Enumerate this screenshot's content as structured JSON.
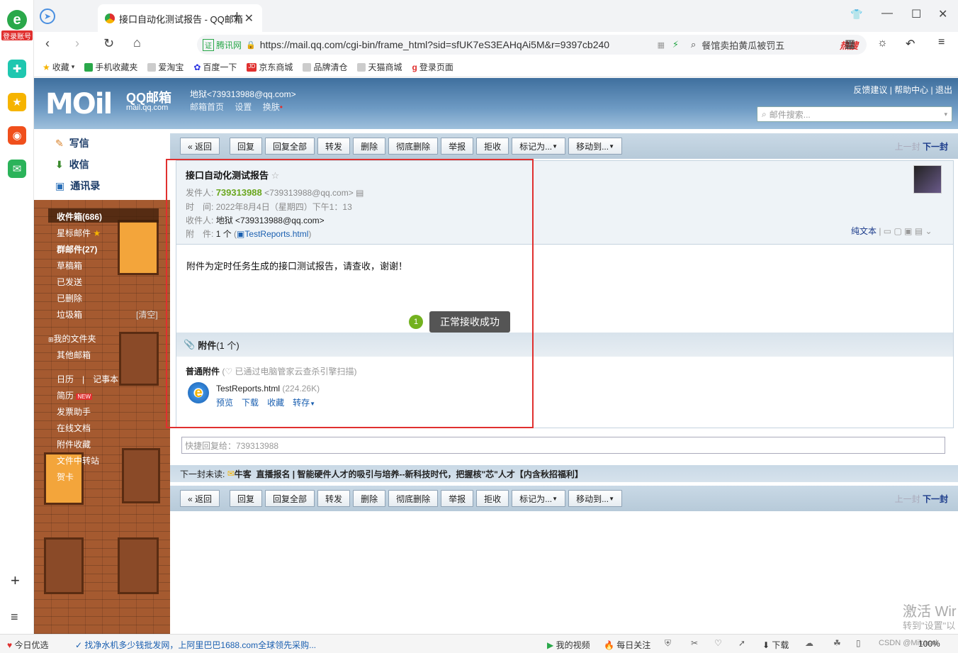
{
  "browser": {
    "tab_title": "接口自动化测试报告 - QQ邮箱",
    "url": "https://mail.qq.com/cgi-bin/frame_html?sid=sfUK7eS3EAHqAi5M&r=9397cb240",
    "site_verify": "腾讯网",
    "search_text": "餐馆卖拍黄瓜被罚五",
    "hot_label": "热搜",
    "rail_login": "登录账号"
  },
  "bookmarks": [
    "收藏",
    "手机收藏夹",
    "爱淘宝",
    "百度一下",
    "京东商城",
    "品牌清仓",
    "天猫商城",
    "登录页面"
  ],
  "mail_header": {
    "logo": "MOil",
    "brand": "QQ邮箱",
    "brand_sub": "mail.qq.com",
    "user": "地狱<739313988@qq.com>",
    "links": [
      "邮箱首页",
      "设置",
      "换肤"
    ],
    "top_links": [
      "反馈建议",
      "帮助中心",
      "退出"
    ],
    "search_placeholder": "邮件搜索..."
  },
  "sidebar": {
    "compose": "写信",
    "inbox_btn": "收信",
    "contacts": "通讯录",
    "folders": [
      "收件箱(686)",
      "星标邮件",
      "群邮件(27)",
      "草稿箱",
      "已发送",
      "已删除",
      "垃圾箱"
    ],
    "clear": "[清空]",
    "my_folders": "我的文件夹",
    "other_mail": "其他邮箱",
    "calendar": "日历",
    "notes": "记事本",
    "resume": "简历",
    "new_badge": "NEW",
    "tools": [
      "发票助手",
      "在线文档",
      "附件收藏",
      "文件中转站",
      "贺卡"
    ]
  },
  "toolbar": {
    "buttons": [
      "« 返回",
      "回复",
      "回复全部",
      "转发",
      "删除",
      "彻底删除",
      "举报",
      "拒收",
      "标记为...",
      "移动到..."
    ],
    "prev": "上一封",
    "next": "下一封"
  },
  "mail": {
    "subject": "接口自动化测试报告",
    "from_label": "发件人:",
    "from_name": "739313988",
    "from_addr": "<739313988@qq.com>",
    "time_label": "时　间:",
    "time": "2022年8月4日（星期四）下午1：13",
    "to_label": "收件人:",
    "to": "地狱 <739313988@qq.com>",
    "attach_label": "附　件:",
    "attach_count": "1 个",
    "attach_name": "TestReports.html",
    "plain_text": "纯文本",
    "body": "附件为定时任务生成的接口测试报告，请查收，谢谢！"
  },
  "attachment": {
    "title": "附件",
    "count": "(1 个)",
    "group": "普通附件",
    "scan": "(♡ 已通过电脑管家云查杀引擎扫描)",
    "file": "TestReports.html",
    "size": "(224.26K)",
    "actions": [
      "预览",
      "下载",
      "收藏",
      "转存"
    ]
  },
  "annotation": {
    "badge": "1",
    "text": "正常接收成功"
  },
  "quick_reply": "快捷回复给：739313988",
  "next_unread": {
    "label": "下一封未读:",
    "from": "牛客",
    "subject": "直播报名 | 智能硬件人才的吸引与培养--新科技时代，把握核\"芯\"人才【内含秋招福利】"
  },
  "statusbar": {
    "left": "今日优选",
    "ad": "找净水机多少钱批发网，上阿里巴巴1688.com全球领先采购...",
    "video": "我的视频",
    "follow": "每日关注",
    "download": "下载",
    "zoom": "100%"
  },
  "watermark": {
    "line1": "激活 Wir",
    "line2": "转到\"设置\"以",
    "csdn": "CSDN @Mikasal"
  },
  "colors": {
    "accent_red": "#e0302f",
    "sender_green": "#6aa61d",
    "badge_green": "#73b21f"
  }
}
